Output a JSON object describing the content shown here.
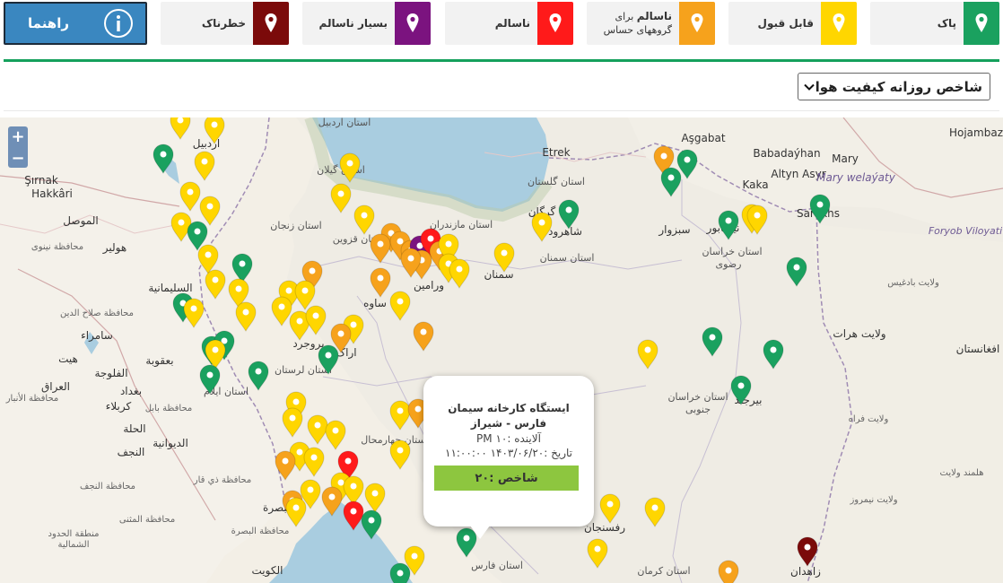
{
  "legend": [
    {
      "label": "پاک",
      "color": "#1aa15f"
    },
    {
      "label": "قابل قبول",
      "color": "#ffd600"
    },
    {
      "label_main": "ناسالم",
      "label_rest": " برای",
      "label_line2": "گروههای حساس",
      "color": "#f6a21c"
    },
    {
      "label": "ناسالم",
      "color": "#ff1a1a"
    },
    {
      "label": "بسیار ناسالم",
      "color": "#7b137f"
    },
    {
      "label": "خطرناک",
      "color": "#7b0a0a"
    }
  ],
  "guide": {
    "label": "راهنما",
    "icon": "info-icon"
  },
  "index_select": {
    "value": "شاخص روزانه کیفیت هوا",
    "icon": "chevron-down-icon"
  },
  "zoom": {
    "in": "+",
    "out": "−"
  },
  "map_labels": [
    "استان اردبیل",
    "استان گیلان",
    "استان زنجان",
    "استان قزوین",
    "استان مازندران",
    "استان گلستان",
    "استان سمنان",
    "استان خراسان رضوی",
    "استان خراسان جنوبی",
    "استان کرمان",
    "استان لرستان",
    "استان ایلام",
    "استان چهارمحال",
    "استان فارس",
    "Aşgabat",
    "Etrek",
    "Babadaýhan",
    "Altyn Asyr",
    "Hojambaz",
    "Kaka",
    "Mary",
    "Mary welaýaty",
    "Şırnak",
    "Hakkâri",
    "الموصل",
    "هولیر",
    "محافظة نينوى",
    "السليمانية",
    "بغداد",
    "كربلاء",
    "الحلة",
    "الديوانية",
    "النجف",
    "العراق",
    "البصرة",
    "الكويت",
    "سامراء",
    "بعقوبة",
    "الفلوجة",
    "هيت",
    "اردبیل",
    "سمنان",
    "شاهرود",
    "سبزوار",
    "نیشابور",
    "بیرجند",
    "رفسنجان",
    "زاهدان",
    "کرمان",
    "اراک",
    "بروجرد",
    "ساوه",
    "ورامین",
    "گرگان",
    "Foryob Viloyati",
    "افغانستان",
    "ولایت هرات",
    "ولایت فراه",
    "ولایت بادغیس",
    "ولایت نیمروز",
    "هلمند ولایت",
    "Sarakhs",
    "محافظة صلاح الدين",
    "محافظة بابل",
    "محافظة النجف",
    "محافظة المثنى",
    "منطقة الحدود الشمالية",
    "محافظة البصرة",
    "محافظة ذي قار",
    "محافظة الأنبار"
  ],
  "popup": {
    "station": "ایستگاه کارخانه سیمان",
    "location": "فارس - شیراز",
    "pollutant": "آلاینده :PM ۱۰",
    "date": "تاریخ :۱۴۰۳/۰۶/۲۰ ۱۱:۰۰:۰۰",
    "index": "شاخص :۲۰",
    "index_color": "#8dc63f"
  }
}
